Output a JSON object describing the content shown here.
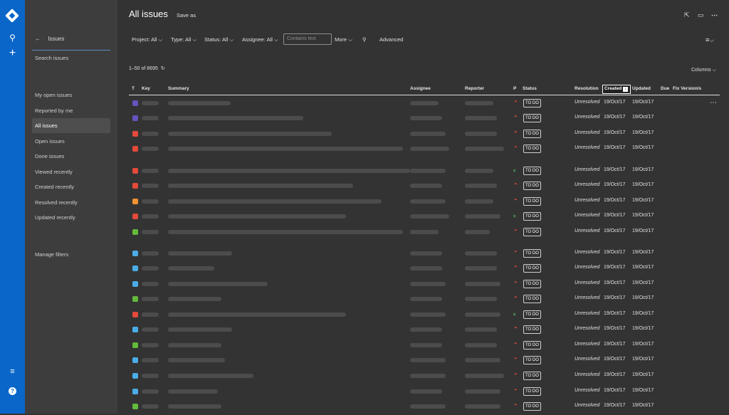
{
  "global_nav": {
    "icons": [
      "app-logo-icon",
      "search-icon",
      "plus-icon",
      "menu-icon",
      "help-icon"
    ]
  },
  "sidebar": {
    "back_label": "Issues",
    "search_label": "Search issues",
    "items": [
      {
        "label": "My open issues",
        "active": false
      },
      {
        "label": "Reported by me",
        "active": false
      },
      {
        "label": "All issues",
        "active": true
      },
      {
        "label": "Open issues",
        "active": false
      },
      {
        "label": "Done issues",
        "active": false
      },
      {
        "label": "Viewed recently",
        "active": false
      },
      {
        "label": "Created recently",
        "active": false
      },
      {
        "label": "Resolved recently",
        "active": false
      },
      {
        "label": "Updated recently",
        "active": false
      }
    ],
    "manage_filters": "Manage filters"
  },
  "header": {
    "title": "All issues",
    "save_as": "Save as"
  },
  "filters": {
    "project": "Project: All",
    "type": "Type: All",
    "status": "Status: All",
    "assignee": "Assignee: All",
    "search_placeholder": "Contains text",
    "more": "More",
    "advanced": "Advanced"
  },
  "results": {
    "count": "1–50 of 8695",
    "columns_label": "Columns"
  },
  "table": {
    "headers": {
      "type": "T",
      "key": "Key",
      "summary": "Summary",
      "assignee": "Assignee",
      "reporter": "Reporter",
      "priority": "P",
      "status": "Status",
      "resolution": "Resolution",
      "created": "Created",
      "updated": "Updated",
      "due": "Due",
      "fix_version": "Fix Version/s"
    },
    "rows": [
      {
        "type_color": "#6554c0",
        "prio": "high",
        "status": "TO DO",
        "resolution": "Unresolved",
        "created": "19/Oct/17",
        "updated": "19/Oct/17"
      },
      {
        "type_color": "#6554c0",
        "prio": "high",
        "status": "TO DO",
        "resolution": "Unresolved",
        "created": "19/Oct/17",
        "updated": "19/Oct/17"
      },
      {
        "type_color": "#e5493a",
        "prio": "high",
        "status": "TO DO",
        "resolution": "Unresolved",
        "created": "19/Oct/17",
        "updated": "19/Oct/17"
      },
      {
        "type_color": "#e5493a",
        "prio": "high",
        "status": "TO DO",
        "resolution": "Unresolved",
        "created": "19/Oct/17",
        "updated": "19/Oct/17"
      },
      {
        "type_color": "#e5493a",
        "prio": "low",
        "status": "TO DO",
        "resolution": "Unresolved",
        "created": "19/Oct/17",
        "updated": "19/Oct/17"
      },
      {
        "type_color": "#e5493a",
        "prio": "high",
        "status": "TO DO",
        "resolution": "Unresolved",
        "created": "19/Oct/17",
        "updated": "19/Oct/17"
      },
      {
        "type_color": "#f79232",
        "prio": "high",
        "status": "TO DO",
        "resolution": "Unresolved",
        "created": "19/Oct/17",
        "updated": "19/Oct/17"
      },
      {
        "type_color": "#e5493a",
        "prio": "low",
        "status": "TO DO",
        "resolution": "Unresolved",
        "created": "19/Oct/17",
        "updated": "19/Oct/17"
      },
      {
        "type_color": "#63ba3c",
        "prio": "high",
        "status": "TO DO",
        "resolution": "Unresolved",
        "created": "19/Oct/17",
        "updated": "19/Oct/17"
      },
      {
        "type_color": "#4bade8",
        "prio": "high",
        "status": "TO DO",
        "resolution": "Unresolved",
        "created": "19/Oct/17",
        "updated": "19/Oct/17"
      },
      {
        "type_color": "#4bade8",
        "prio": "high",
        "status": "TO DO",
        "resolution": "Unresolved",
        "created": "19/Oct/17",
        "updated": "19/Oct/17"
      },
      {
        "type_color": "#4bade8",
        "prio": "high",
        "status": "TO DO",
        "resolution": "Unresolved",
        "created": "19/Oct/17",
        "updated": "19/Oct/17"
      },
      {
        "type_color": "#63ba3c",
        "prio": "high",
        "status": "TO DO",
        "resolution": "Unresolved",
        "created": "19/Oct/17",
        "updated": "19/Oct/17"
      },
      {
        "type_color": "#e5493a",
        "prio": "low",
        "status": "TO DO",
        "resolution": "Unresolved",
        "created": "19/Oct/17",
        "updated": "19/Oct/17"
      },
      {
        "type_color": "#4bade8",
        "prio": "high",
        "status": "TO DO",
        "resolution": "Unresolved",
        "created": "19/Oct/17",
        "updated": "19/Oct/17"
      },
      {
        "type_color": "#63ba3c",
        "prio": "high",
        "status": "TO DO",
        "resolution": "Unresolved",
        "created": "19/Oct/17",
        "updated": "19/Oct/17"
      },
      {
        "type_color": "#4bade8",
        "prio": "high",
        "status": "TO DO",
        "resolution": "Unresolved",
        "created": "19/Oct/17",
        "updated": "19/Oct/17"
      },
      {
        "type_color": "#4bade8",
        "prio": "high",
        "status": "TO DO",
        "resolution": "Unresolved",
        "created": "19/Oct/17",
        "updated": "19/Oct/17"
      },
      {
        "type_color": "#4bade8",
        "prio": "high",
        "status": "TO DO",
        "resolution": "Unresolved",
        "created": "19/Oct/17",
        "updated": "19/Oct/17"
      },
      {
        "type_color": "#63ba3c",
        "prio": "high",
        "status": "TO DO",
        "resolution": "Unresolved",
        "created": "19/Oct/17",
        "updated": "19/Oct/17"
      }
    ]
  }
}
